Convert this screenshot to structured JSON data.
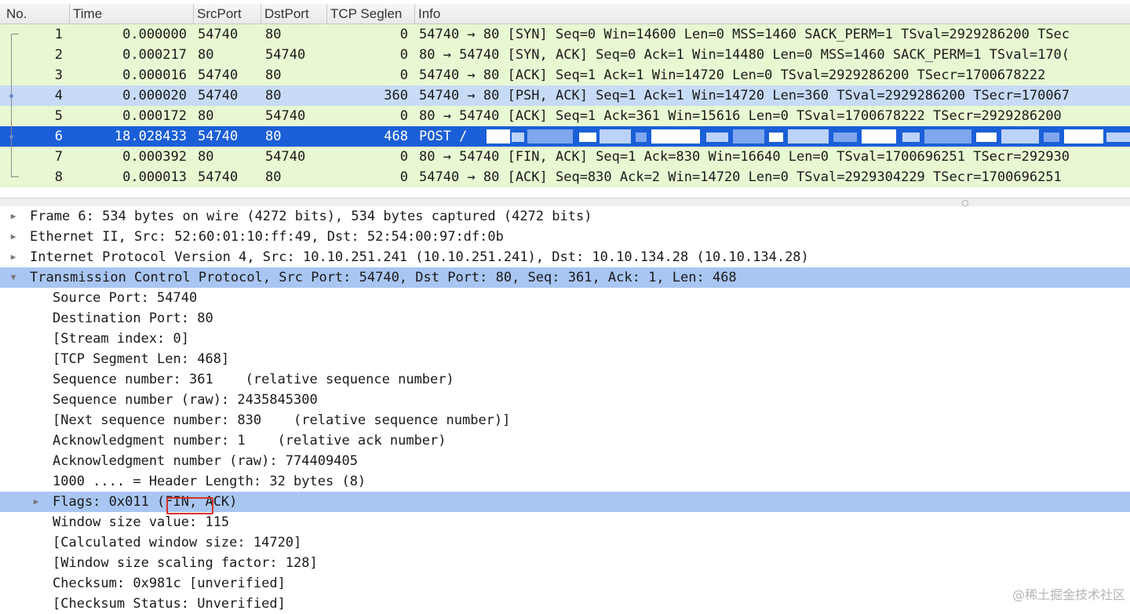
{
  "columns": [
    {
      "key": "no",
      "label": "No."
    },
    {
      "key": "time",
      "label": "Time"
    },
    {
      "key": "srcport",
      "label": "SrcPort"
    },
    {
      "key": "dstport",
      "label": "DstPort"
    },
    {
      "key": "seglen",
      "label": "TCP Seglen"
    },
    {
      "key": "info",
      "label": "Info"
    }
  ],
  "packets": [
    {
      "no": "1",
      "time": "0.000000",
      "src": "54740",
      "dst": "80",
      "seglen": "0",
      "info": "54740 → 80 [SYN] Seq=0 Win=14600 Len=0 MSS=1460 SACK_PERM=1 TSval=2929286200 TSec",
      "bg": "#e8f8d2"
    },
    {
      "no": "2",
      "time": "0.000217",
      "src": "80",
      "dst": "54740",
      "seglen": "0",
      "info": "80 → 54740 [SYN, ACK] Seq=0 Ack=1 Win=14480 Len=0 MSS=1460 SACK_PERM=1 TSval=170(",
      "bg": "#e8f8d2"
    },
    {
      "no": "3",
      "time": "0.000016",
      "src": "54740",
      "dst": "80",
      "seglen": "0",
      "info": "54740 → 80 [ACK] Seq=1 Ack=1 Win=14720 Len=0 TSval=2929286200 TSecr=1700678222",
      "bg": "#e8f8d2"
    },
    {
      "no": "4",
      "time": "0.000020",
      "src": "54740",
      "dst": "80",
      "seglen": "360",
      "info": "54740 → 80 [PSH, ACK] Seq=1 Ack=1 Win=14720 Len=360 TSval=2929286200 TSecr=170067",
      "bg": "#c7dbf7"
    },
    {
      "no": "5",
      "time": "0.000172",
      "src": "80",
      "dst": "54740",
      "seglen": "0",
      "info": "80 → 54740 [ACK] Seq=1 Ack=361 Win=15616 Len=0 TSval=1700678222 TSecr=2929286200",
      "bg": "#e8f8d2"
    },
    {
      "no": "6",
      "time": "18.028433",
      "src": "54740",
      "dst": "80",
      "seglen": "468",
      "info": "POST /",
      "bg": "#1b5fd8"
    },
    {
      "no": "7",
      "time": "0.000392",
      "src": "80",
      "dst": "54740",
      "seglen": "0",
      "info": "80 → 54740 [FIN, ACK] Seq=1 Ack=830 Win=16640 Len=0 TSval=1700696251 TSecr=292930",
      "bg": "#e8f8d2"
    },
    {
      "no": "8",
      "time": "0.000013",
      "src": "54740",
      "dst": "80",
      "seglen": "0",
      "info": "54740 → 80 [ACK] Seq=830 Ack=2 Win=14720 Len=0 TSval=2929304229 TSecr=1700696251",
      "bg": "#e8f8d2"
    }
  ],
  "selected_packet": "6",
  "colors": {
    "tcp_row": "#e8f8d2",
    "psh_row": "#c7dbf7",
    "selected_row": "#1b5fd8",
    "detail_highlight": "#a9c6f2",
    "annotation_box": "#d8302a"
  },
  "details": [
    {
      "level": 0,
      "expander": "collapsed",
      "text": "Frame 6: 534 bytes on wire (4272 bits), 534 bytes captured (4272 bits)",
      "highlight": false
    },
    {
      "level": 0,
      "expander": "collapsed",
      "text": "Ethernet II, Src: 52:60:01:10:ff:49, Dst: 52:54:00:97:df:0b",
      "highlight": false
    },
    {
      "level": 0,
      "expander": "collapsed",
      "text": "Internet Protocol Version 4, Src: 10.10.251.241 (10.10.251.241), Dst: 10.10.134.28 (10.10.134.28)",
      "highlight": false
    },
    {
      "level": 0,
      "expander": "expanded",
      "text": "Transmission Control Protocol, Src Port: 54740, Dst Port: 80, Seq: 361, Ack: 1, Len: 468",
      "highlight": true
    },
    {
      "level": 1,
      "expander": "none",
      "text": "Source Port: 54740",
      "highlight": false
    },
    {
      "level": 1,
      "expander": "none",
      "text": "Destination Port: 80",
      "highlight": false
    },
    {
      "level": 1,
      "expander": "none",
      "text": "[Stream index: 0]",
      "highlight": false
    },
    {
      "level": 1,
      "expander": "none",
      "text": "[TCP Segment Len: 468]",
      "highlight": false
    },
    {
      "level": 1,
      "expander": "none",
      "text": "Sequence number: 361    (relative sequence number)",
      "highlight": false
    },
    {
      "level": 1,
      "expander": "none",
      "text": "Sequence number (raw): 2435845300",
      "highlight": false
    },
    {
      "level": 1,
      "expander": "none",
      "text": "[Next sequence number: 830    (relative sequence number)]",
      "highlight": false
    },
    {
      "level": 1,
      "expander": "none",
      "text": "Acknowledgment number: 1    (relative ack number)",
      "highlight": false
    },
    {
      "level": 1,
      "expander": "none",
      "text": "Acknowledgment number (raw): 774409405",
      "highlight": false
    },
    {
      "level": 1,
      "expander": "none",
      "text": "1000 .... = Header Length: 32 bytes (8)",
      "highlight": false
    },
    {
      "level": 1,
      "expander": "collapsed",
      "text": "Flags: 0x011 (FIN, ACK)",
      "highlight": true
    },
    {
      "level": 1,
      "expander": "none",
      "text": "Window size value: 115",
      "highlight": false
    },
    {
      "level": 1,
      "expander": "none",
      "text": "[Calculated window size: 14720]",
      "highlight": false
    },
    {
      "level": 1,
      "expander": "none",
      "text": "[Window size scaling factor: 128]",
      "highlight": false
    },
    {
      "level": 1,
      "expander": "none",
      "text": "Checksum: 0x981c [unverified]",
      "highlight": false
    },
    {
      "level": 1,
      "expander": "none",
      "text": "[Checksum Status: Unverified]",
      "highlight": false
    }
  ],
  "watermark": "@稀土掘金技术社区"
}
